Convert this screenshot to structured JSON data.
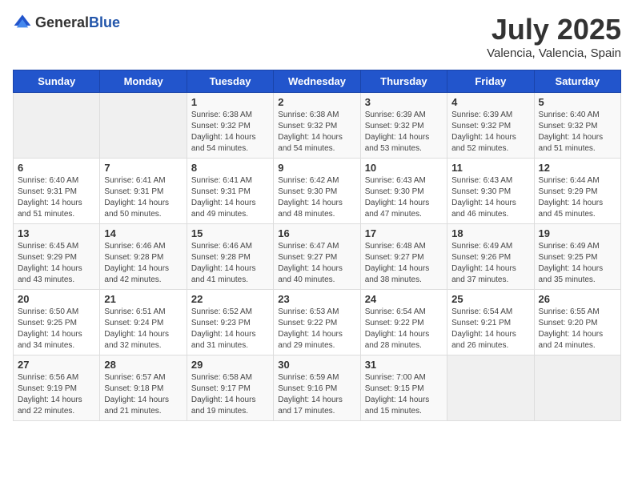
{
  "header": {
    "logo_general": "General",
    "logo_blue": "Blue",
    "month_year": "July 2025",
    "location": "Valencia, Valencia, Spain"
  },
  "weekdays": [
    "Sunday",
    "Monday",
    "Tuesday",
    "Wednesday",
    "Thursday",
    "Friday",
    "Saturday"
  ],
  "weeks": [
    [
      {
        "day": "",
        "sunrise": "",
        "sunset": "",
        "daylight": ""
      },
      {
        "day": "",
        "sunrise": "",
        "sunset": "",
        "daylight": ""
      },
      {
        "day": "1",
        "sunrise": "Sunrise: 6:38 AM",
        "sunset": "Sunset: 9:32 PM",
        "daylight": "Daylight: 14 hours and 54 minutes."
      },
      {
        "day": "2",
        "sunrise": "Sunrise: 6:38 AM",
        "sunset": "Sunset: 9:32 PM",
        "daylight": "Daylight: 14 hours and 54 minutes."
      },
      {
        "day": "3",
        "sunrise": "Sunrise: 6:39 AM",
        "sunset": "Sunset: 9:32 PM",
        "daylight": "Daylight: 14 hours and 53 minutes."
      },
      {
        "day": "4",
        "sunrise": "Sunrise: 6:39 AM",
        "sunset": "Sunset: 9:32 PM",
        "daylight": "Daylight: 14 hours and 52 minutes."
      },
      {
        "day": "5",
        "sunrise": "Sunrise: 6:40 AM",
        "sunset": "Sunset: 9:32 PM",
        "daylight": "Daylight: 14 hours and 51 minutes."
      }
    ],
    [
      {
        "day": "6",
        "sunrise": "Sunrise: 6:40 AM",
        "sunset": "Sunset: 9:31 PM",
        "daylight": "Daylight: 14 hours and 51 minutes."
      },
      {
        "day": "7",
        "sunrise": "Sunrise: 6:41 AM",
        "sunset": "Sunset: 9:31 PM",
        "daylight": "Daylight: 14 hours and 50 minutes."
      },
      {
        "day": "8",
        "sunrise": "Sunrise: 6:41 AM",
        "sunset": "Sunset: 9:31 PM",
        "daylight": "Daylight: 14 hours and 49 minutes."
      },
      {
        "day": "9",
        "sunrise": "Sunrise: 6:42 AM",
        "sunset": "Sunset: 9:30 PM",
        "daylight": "Daylight: 14 hours and 48 minutes."
      },
      {
        "day": "10",
        "sunrise": "Sunrise: 6:43 AM",
        "sunset": "Sunset: 9:30 PM",
        "daylight": "Daylight: 14 hours and 47 minutes."
      },
      {
        "day": "11",
        "sunrise": "Sunrise: 6:43 AM",
        "sunset": "Sunset: 9:30 PM",
        "daylight": "Daylight: 14 hours and 46 minutes."
      },
      {
        "day": "12",
        "sunrise": "Sunrise: 6:44 AM",
        "sunset": "Sunset: 9:29 PM",
        "daylight": "Daylight: 14 hours and 45 minutes."
      }
    ],
    [
      {
        "day": "13",
        "sunrise": "Sunrise: 6:45 AM",
        "sunset": "Sunset: 9:29 PM",
        "daylight": "Daylight: 14 hours and 43 minutes."
      },
      {
        "day": "14",
        "sunrise": "Sunrise: 6:46 AM",
        "sunset": "Sunset: 9:28 PM",
        "daylight": "Daylight: 14 hours and 42 minutes."
      },
      {
        "day": "15",
        "sunrise": "Sunrise: 6:46 AM",
        "sunset": "Sunset: 9:28 PM",
        "daylight": "Daylight: 14 hours and 41 minutes."
      },
      {
        "day": "16",
        "sunrise": "Sunrise: 6:47 AM",
        "sunset": "Sunset: 9:27 PM",
        "daylight": "Daylight: 14 hours and 40 minutes."
      },
      {
        "day": "17",
        "sunrise": "Sunrise: 6:48 AM",
        "sunset": "Sunset: 9:27 PM",
        "daylight": "Daylight: 14 hours and 38 minutes."
      },
      {
        "day": "18",
        "sunrise": "Sunrise: 6:49 AM",
        "sunset": "Sunset: 9:26 PM",
        "daylight": "Daylight: 14 hours and 37 minutes."
      },
      {
        "day": "19",
        "sunrise": "Sunrise: 6:49 AM",
        "sunset": "Sunset: 9:25 PM",
        "daylight": "Daylight: 14 hours and 35 minutes."
      }
    ],
    [
      {
        "day": "20",
        "sunrise": "Sunrise: 6:50 AM",
        "sunset": "Sunset: 9:25 PM",
        "daylight": "Daylight: 14 hours and 34 minutes."
      },
      {
        "day": "21",
        "sunrise": "Sunrise: 6:51 AM",
        "sunset": "Sunset: 9:24 PM",
        "daylight": "Daylight: 14 hours and 32 minutes."
      },
      {
        "day": "22",
        "sunrise": "Sunrise: 6:52 AM",
        "sunset": "Sunset: 9:23 PM",
        "daylight": "Daylight: 14 hours and 31 minutes."
      },
      {
        "day": "23",
        "sunrise": "Sunrise: 6:53 AM",
        "sunset": "Sunset: 9:22 PM",
        "daylight": "Daylight: 14 hours and 29 minutes."
      },
      {
        "day": "24",
        "sunrise": "Sunrise: 6:54 AM",
        "sunset": "Sunset: 9:22 PM",
        "daylight": "Daylight: 14 hours and 28 minutes."
      },
      {
        "day": "25",
        "sunrise": "Sunrise: 6:54 AM",
        "sunset": "Sunset: 9:21 PM",
        "daylight": "Daylight: 14 hours and 26 minutes."
      },
      {
        "day": "26",
        "sunrise": "Sunrise: 6:55 AM",
        "sunset": "Sunset: 9:20 PM",
        "daylight": "Daylight: 14 hours and 24 minutes."
      }
    ],
    [
      {
        "day": "27",
        "sunrise": "Sunrise: 6:56 AM",
        "sunset": "Sunset: 9:19 PM",
        "daylight": "Daylight: 14 hours and 22 minutes."
      },
      {
        "day": "28",
        "sunrise": "Sunrise: 6:57 AM",
        "sunset": "Sunset: 9:18 PM",
        "daylight": "Daylight: 14 hours and 21 minutes."
      },
      {
        "day": "29",
        "sunrise": "Sunrise: 6:58 AM",
        "sunset": "Sunset: 9:17 PM",
        "daylight": "Daylight: 14 hours and 19 minutes."
      },
      {
        "day": "30",
        "sunrise": "Sunrise: 6:59 AM",
        "sunset": "Sunset: 9:16 PM",
        "daylight": "Daylight: 14 hours and 17 minutes."
      },
      {
        "day": "31",
        "sunrise": "Sunrise: 7:00 AM",
        "sunset": "Sunset: 9:15 PM",
        "daylight": "Daylight: 14 hours and 15 minutes."
      },
      {
        "day": "",
        "sunrise": "",
        "sunset": "",
        "daylight": ""
      },
      {
        "day": "",
        "sunrise": "",
        "sunset": "",
        "daylight": ""
      }
    ]
  ]
}
